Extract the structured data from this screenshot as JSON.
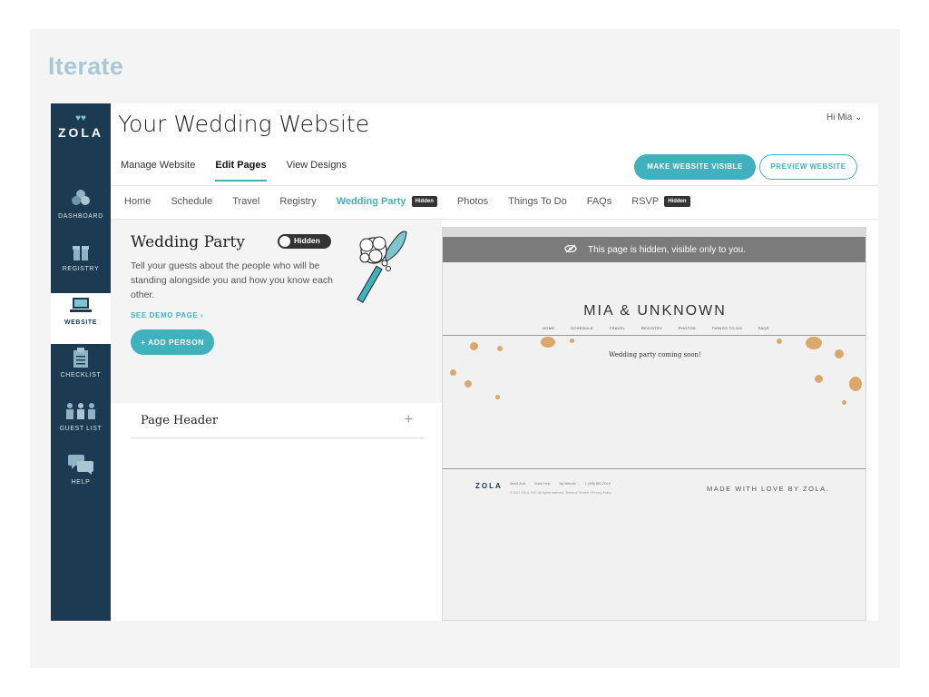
{
  "slide": {
    "title": "Iterate"
  },
  "sidebar": {
    "logo_text": "ZOLA",
    "items": [
      {
        "label": "DASHBOARD",
        "icon": "dashboard-icon",
        "active": false
      },
      {
        "label": "REGISTRY",
        "icon": "gift-icon",
        "active": false
      },
      {
        "label": "WEBSITE",
        "icon": "laptop-icon",
        "active": true
      },
      {
        "label": "CHECKLIST",
        "icon": "clipboard-icon",
        "active": false
      },
      {
        "label": "GUEST LIST",
        "icon": "people-icon",
        "active": false
      },
      {
        "label": "HELP",
        "icon": "chat-icon",
        "active": false
      }
    ]
  },
  "header": {
    "title": "Your Wedding Website",
    "greeting": "Hi Mia",
    "tabs": [
      "Manage Website",
      "Edit Pages",
      "View Designs"
    ],
    "active_tab": "Edit Pages",
    "make_visible_label": "MAKE WEBSITE VISIBLE",
    "preview_label": "PREVIEW WEBSITE"
  },
  "subnav": {
    "items": [
      "Home",
      "Schedule",
      "Travel",
      "Registry",
      "Wedding Party",
      "Photos",
      "Things To Do",
      "FAQs",
      "RSVP"
    ],
    "active": "Wedding Party",
    "hidden_badge": "Hidden"
  },
  "panel": {
    "title": "Wedding Party",
    "toggle_label": "Hidden",
    "description": "Tell your guests about the people who will be standing alongside you and how you know each other.",
    "demo_link": "SEE DEMO PAGE ›",
    "add_button": "+ ADD PERSON",
    "page_header_label": "Page Header",
    "expand_symbol": "+"
  },
  "preview": {
    "hidden_message": "This page is hidden, visible only to you.",
    "couple_name": "MIA & UNKNOWN",
    "nav": [
      "HOME",
      "SCHEDULE",
      "TRAVEL",
      "REGISTRY",
      "PHOTOS",
      "THINGS TO DO",
      "FAQS"
    ],
    "coming_soon": "Wedding party coming soon!",
    "footer_logo": "ZOLA",
    "footer_links": [
      "About Zola",
      "Guest Help",
      "My Website",
      "1 (408) 651-ZOLA"
    ],
    "footer_copyright": "© 2017 ZOLA, INC. All rights reserved. Terms of Service / Privacy Policy",
    "made_with": "MADE WITH LOVE BY ZOLA."
  },
  "colors": {
    "accent": "#3fb2bd",
    "sidebar": "#1c3b52",
    "gold": "#d9a86a"
  }
}
